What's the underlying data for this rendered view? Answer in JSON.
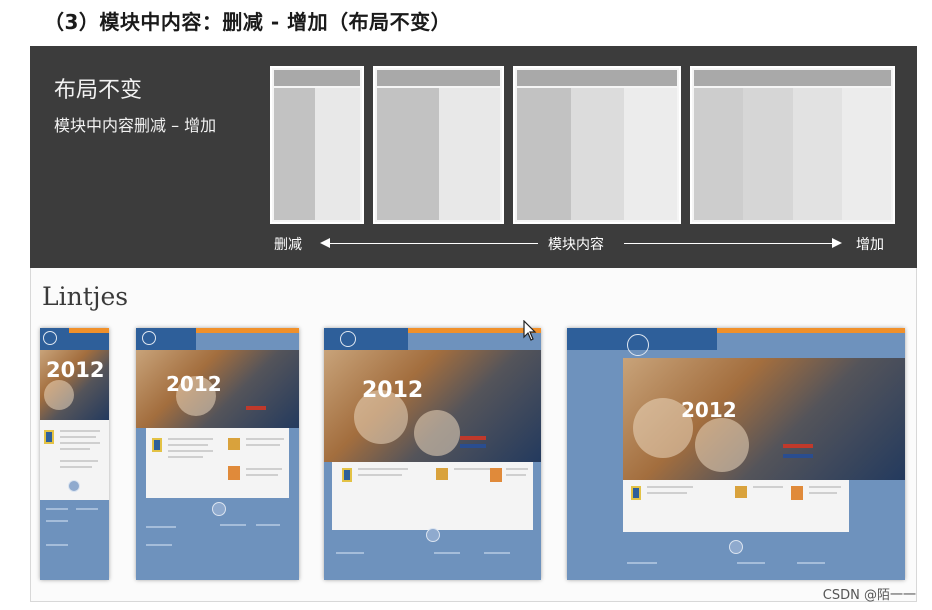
{
  "heading": "（3）模块中内容：删减 - 增加（布局不变）",
  "diagram": {
    "title": "布局不变",
    "subtitle": "模块中内容删减 – 增加",
    "left_label": "删减",
    "center_label": "模块内容",
    "right_label": "增加"
  },
  "lintjes": {
    "label": "Lintjes",
    "year": "2012"
  },
  "colors": {
    "dark_bg": "#3c3c3c",
    "site_blue": "#6e92bd",
    "accent_orange": "#f0902a"
  },
  "watermark": "CSDN @陌一一"
}
